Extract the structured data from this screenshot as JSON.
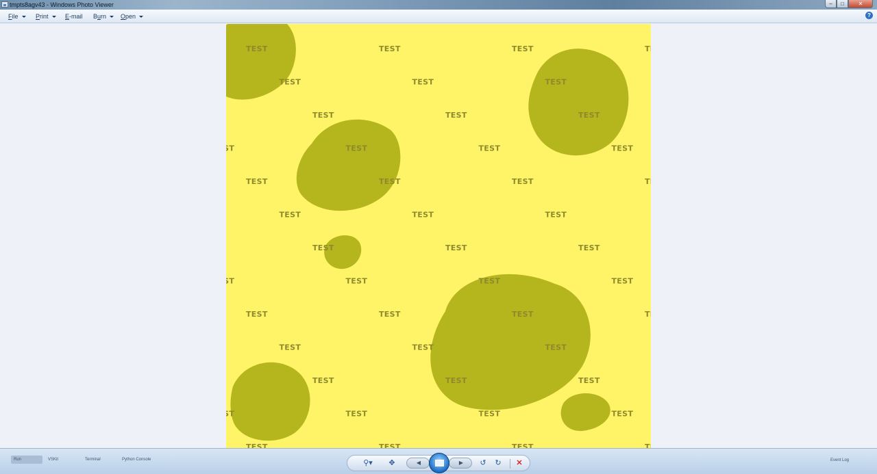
{
  "window": {
    "title": "tmpts8agv43 - Windows Photo Viewer",
    "buttons": {
      "minimize": "–",
      "maximize": "□",
      "close": "✕"
    }
  },
  "menu": [
    {
      "label": "File",
      "key": "F",
      "rest": "ile"
    },
    {
      "label": "Print",
      "key": "P",
      "rest": "rint"
    },
    {
      "label": "E-mail",
      "key": "E",
      "rest": "-mail"
    },
    {
      "label": "Burn",
      "key": "u",
      "pre": "B",
      "rest": "rn"
    },
    {
      "label": "Open",
      "key": "O",
      "rest": "pen"
    }
  ],
  "help_icon": "?",
  "image": {
    "background_color": "#fff467",
    "blob_color": "#b5b61d",
    "label": "TEST",
    "label_color": "#8e8a2c"
  },
  "bottom_bar": {
    "taskbar_items": [
      "Run",
      "VSKit",
      "Terminal",
      "Python Console"
    ],
    "controls": {
      "zoom": "⚲▾",
      "actual_size": "✥",
      "previous": "◀",
      "next": "▶",
      "rotate_ccw": "↺",
      "rotate_cw": "↻",
      "delete": "✕"
    },
    "event_log": "Event Log"
  }
}
